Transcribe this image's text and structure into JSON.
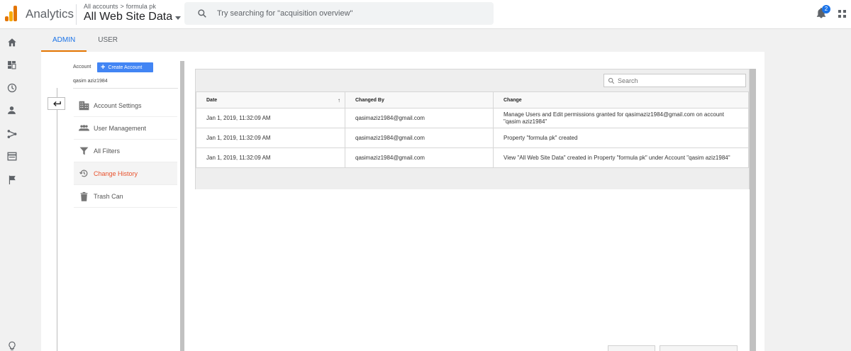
{
  "header": {
    "app_name": "Analytics",
    "breadcrumb": [
      "All accounts",
      "formula pk"
    ],
    "breadcrumb_sep": ">",
    "view_name": "All Web Site Data",
    "search_placeholder": "Try searching for \"acquisition overview\"",
    "notification_count": "2"
  },
  "left_rail": {
    "icons": [
      "home-icon",
      "dashboard-icon",
      "clock-icon",
      "person-icon",
      "acquisition-icon",
      "behavior-icon",
      "flag-icon",
      "lightbulb-icon"
    ]
  },
  "tabs": [
    {
      "label": "ADMIN",
      "active": true
    },
    {
      "label": "USER",
      "active": false
    }
  ],
  "account": {
    "label": "Account",
    "create_button": "Create Account",
    "name": "qasim aziz1984"
  },
  "nav": {
    "items": [
      {
        "label": "Account Settings",
        "icon": "building-icon"
      },
      {
        "label": "User Management",
        "icon": "people-icon"
      },
      {
        "label": "All Filters",
        "icon": "filter-icon"
      },
      {
        "label": "Change History",
        "icon": "history-icon",
        "active": true
      },
      {
        "label": "Trash Can",
        "icon": "trash-icon"
      }
    ]
  },
  "table": {
    "search_placeholder": "Search",
    "columns": [
      "Date",
      "Changed By",
      "Change"
    ],
    "rows": [
      {
        "date": "Jan 1, 2019, 11:32:09 AM",
        "changed_by": "qasimaziz1984@gmail.com",
        "change": "Manage Users and Edit permissions granted for qasimaziz1984@gmail.com on account \"qasim aziz1984\""
      },
      {
        "date": "Jan 1, 2019, 11:32:09 AM",
        "changed_by": "qasimaziz1984@gmail.com",
        "change": "Property \"formula pk\" created"
      },
      {
        "date": "Jan 1, 2019, 11:32:09 AM",
        "changed_by": "qasimaziz1984@gmail.com",
        "change": "View \"All Web Site Data\" created in Property \"formula pk\" under Account \"qasim aziz1984\""
      }
    ]
  },
  "colors": {
    "accent": "#1a73e8",
    "brand_orange": "#e37400",
    "active_nav": "#e8512c",
    "create_button": "#4285f4"
  }
}
